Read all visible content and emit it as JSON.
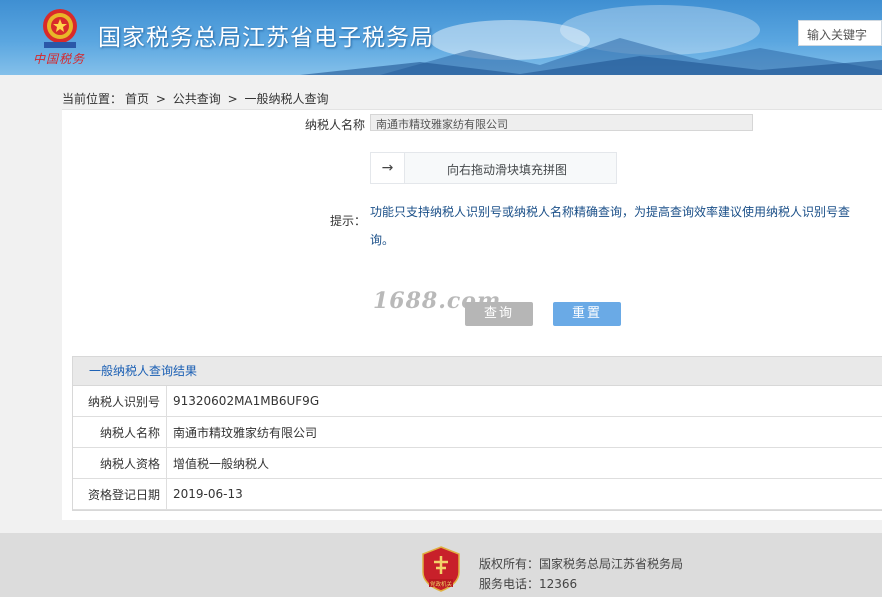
{
  "header": {
    "title": "国家税务总局江苏省电子税务局",
    "slogan": "中国税务",
    "search_placeholder": "输入关键字",
    "emblem_icon": "national-emblem-icon"
  },
  "breadcrumb": {
    "prefix": "当前位置：",
    "items": [
      "首页",
      "公共查询",
      "一般纳税人查询"
    ],
    "separator": ">"
  },
  "form": {
    "name_label": "纳税人名称",
    "name_value": "南通市精玟雅家纺有限公司",
    "slider_text": "向右拖动滑块填充拼图",
    "slider_arrow": "→",
    "hint_label": "提示：",
    "hint_text": "功能只支持纳税人识别号或纳税人名称精确查询，为提高查询效率建议使用纳税人识别号查询。",
    "query_button": "查询",
    "reset_button": "重置"
  },
  "watermark": "1688.com",
  "results": {
    "title": "一般纳税人查询结果",
    "rows": [
      {
        "label": "纳税人识别号",
        "value": "91320602MA1MB6UF9G"
      },
      {
        "label": "纳税人名称",
        "value": "南通市精玟雅家纺有限公司"
      },
      {
        "label": "纳税人资格",
        "value": "增值税一般纳税人"
      },
      {
        "label": "资格登记日期",
        "value": "2019-06-13"
      }
    ]
  },
  "footer": {
    "copyright": "版权所有：国家税务总局江苏省税务局",
    "phone": "服务电话：12366",
    "logo_text": "党政机关"
  },
  "colors": {
    "header_blue": "#4c9bd9",
    "link_blue": "#1a5fb4",
    "reset_button": "#6aaae6",
    "query_button": "#b6b6b6"
  }
}
